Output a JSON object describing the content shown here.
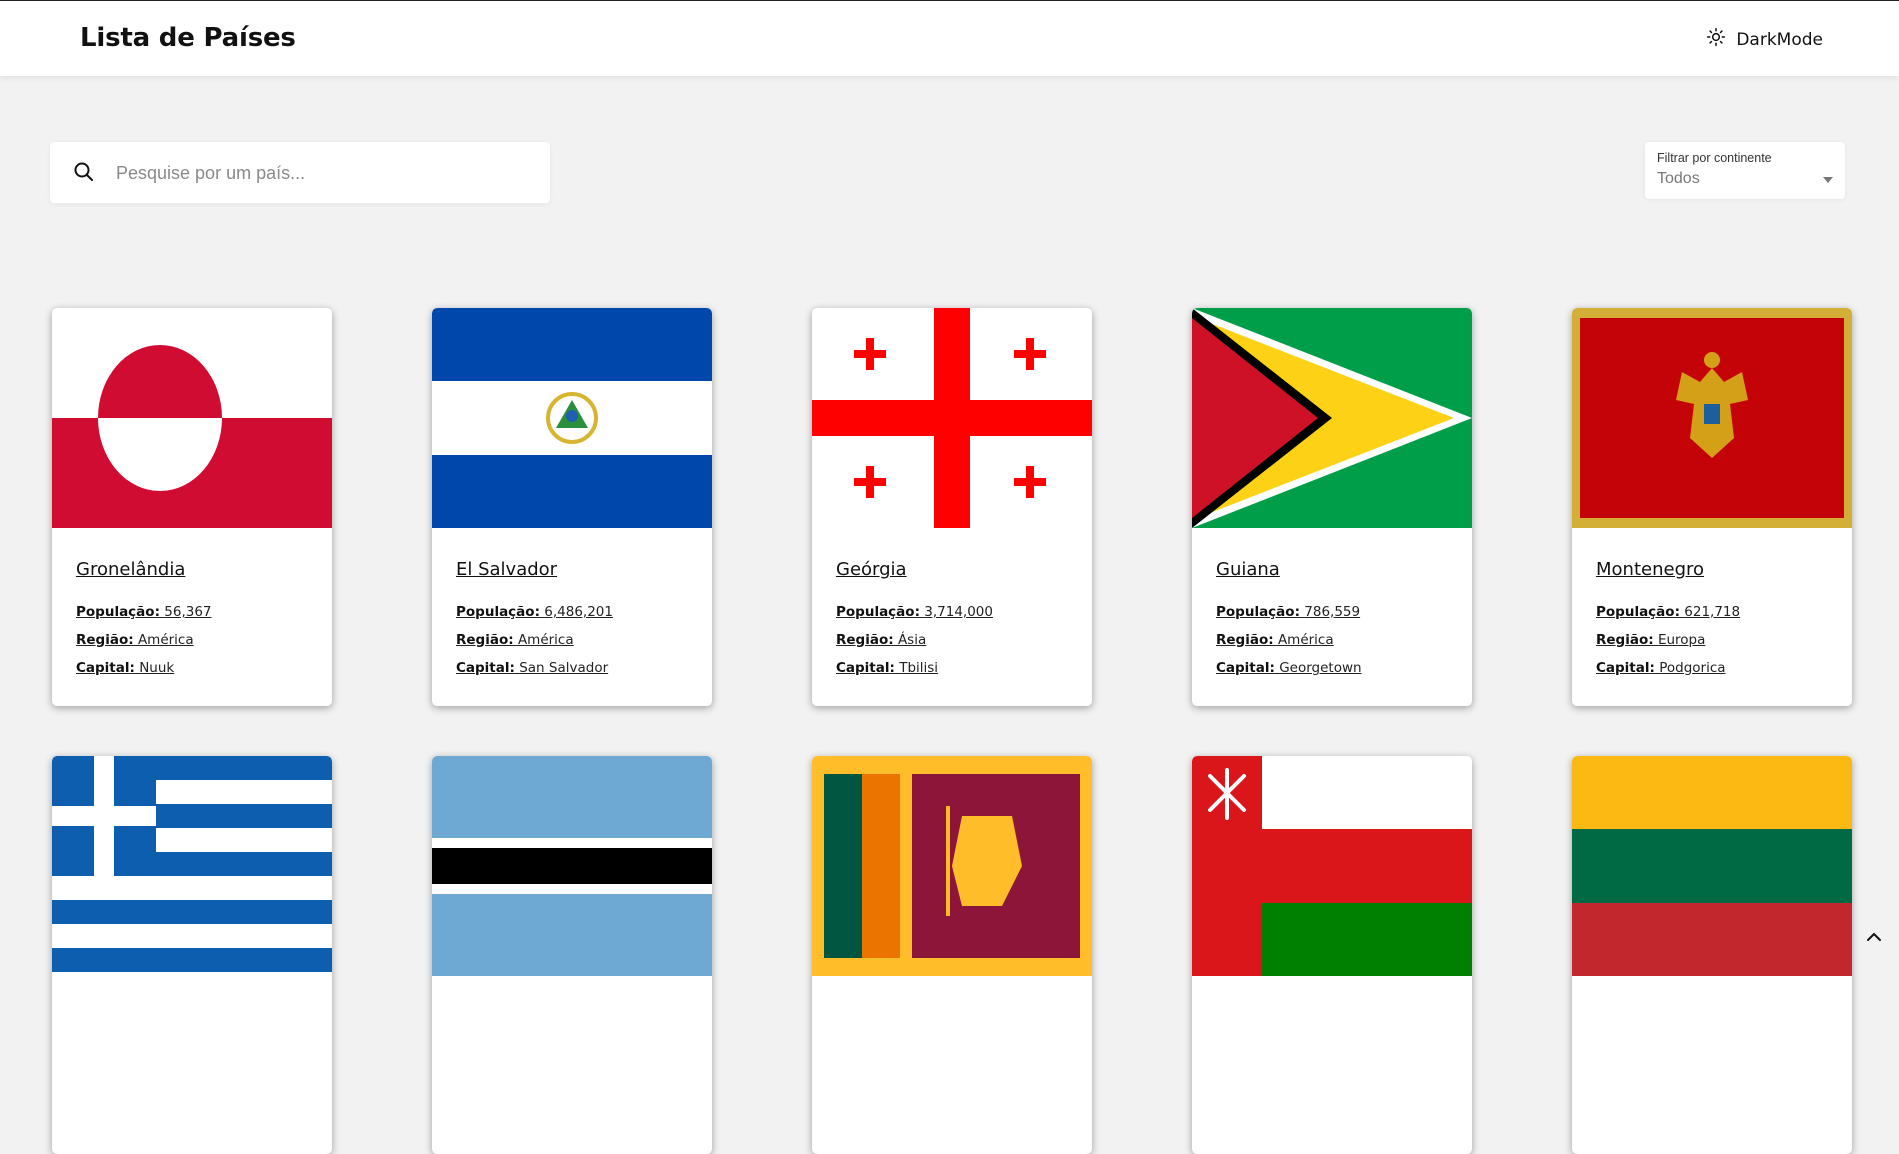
{
  "header": {
    "title": "Lista de Países",
    "darkmode_label": "DarkMode",
    "darkmode_icon": "sun-icon"
  },
  "search": {
    "placeholder": "Pesquise por um país...",
    "value": "",
    "icon": "search-icon"
  },
  "filter": {
    "label": "Filtrar por continente",
    "value": "Todos"
  },
  "labels": {
    "population": "População:",
    "region": "Região:",
    "capital": "Capital:"
  },
  "countries": [
    {
      "name": "Gronelândia",
      "population": "56,367",
      "region": "América",
      "capital": "Nuuk",
      "flag": "greenland-flag"
    },
    {
      "name": "El Salvador",
      "population": "6,486,201",
      "region": "América",
      "capital": "San Salvador",
      "flag": "el-salvador-flag"
    },
    {
      "name": "Geórgia",
      "population": "3,714,000",
      "region": "Ásia",
      "capital": "Tbilisi",
      "flag": "georgia-flag"
    },
    {
      "name": "Guiana",
      "population": "786,559",
      "region": "América",
      "capital": "Georgetown",
      "flag": "guyana-flag"
    },
    {
      "name": "Montenegro",
      "population": "621,718",
      "region": "Europa",
      "capital": "Podgorica",
      "flag": "montenegro-flag"
    }
  ],
  "second_row_flags": [
    "greece-flag",
    "botswana-flag",
    "sri-lanka-flag",
    "oman-flag",
    "lithuania-flag"
  ],
  "colors": {
    "background": "#f2f2f2",
    "card": "#ffffff",
    "header": "#ffffff"
  },
  "scroll_top_icon": "chevron-up-icon"
}
